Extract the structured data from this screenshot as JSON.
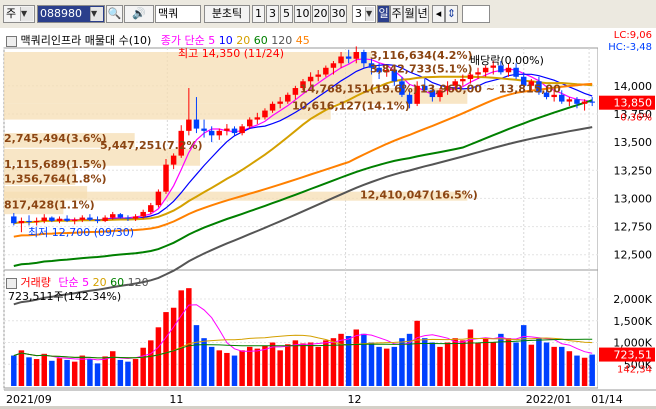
{
  "toolbar": {
    "market": "주",
    "code": "088980",
    "name": "맥쿼",
    "period_label": "분초틱",
    "periods": [
      "1",
      "3",
      "5",
      "10",
      "20",
      "30"
    ],
    "minute_value": "3",
    "day": "일",
    "week": "주",
    "month": "월",
    "year": "년"
  },
  "price_panel": {
    "title": "맥쿼리인프라 매물대 수(10)",
    "ma_label": "종가 단순",
    "ma_periods": [
      "5",
      "10",
      "20",
      "60",
      "120",
      "45"
    ],
    "lc_label": "LC:9,06",
    "hc_label": "HC:-3,48",
    "current_price": "13,850",
    "change_pct": "0.36%",
    "high_note": "최고 14,350 (11/24)",
    "low_note": "최저 12,700 (09/30)",
    "ex_dividend_note": "배당락(0.00%)",
    "volume_profile_labels": [
      "3,116,634(4.2%)",
      "3,842,733(5.1%)",
      "14,768,151(19.6%)",
      "13,960,00 ~ 13,815,00",
      "10,616,127(14.1%)",
      "2,745,494(3.6%)",
      "5,447,251(7.2%)",
      "1,115,689(1.5%)",
      "1,356,764(1.8%)",
      "817,428(1.1%)",
      "12,410,047(16.5%)"
    ]
  },
  "volume_panel": {
    "title": "거래량",
    "ma_label": "단순",
    "ma_periods": [
      "5",
      "20",
      "60",
      "120"
    ],
    "current_volume": "723,511주(142.34%)",
    "right_badge": "723,51",
    "right_badge2": "142,34"
  },
  "chart_data": {
    "type": "candlestick",
    "title": "맥쿼리인프라 매물대 수(10)",
    "price_axis_ticks": [
      12500,
      12750,
      13000,
      13250,
      13500,
      13750,
      14000
    ],
    "price_ylim": [
      12400,
      14300
    ],
    "volume_axis_ticks": [
      "500K",
      "1,000K",
      "1,500K",
      "2,000K"
    ],
    "volume_ylim": [
      0,
      2300
    ],
    "date_ticks": [
      "2021/09",
      "11",
      "12",
      "2022/01",
      "01/14"
    ],
    "candles": [
      [
        12840,
        12870,
        12760,
        12780,
        700
      ],
      [
        12780,
        12830,
        12700,
        12800,
        820
      ],
      [
        12800,
        12850,
        12760,
        12790,
        660
      ],
      [
        12790,
        12830,
        12760,
        12800,
        620
      ],
      [
        12800,
        12860,
        12780,
        12830,
        740
      ],
      [
        12830,
        12840,
        12790,
        12800,
        580
      ],
      [
        12800,
        12840,
        12780,
        12820,
        640
      ],
      [
        12820,
        12850,
        12790,
        12800,
        600
      ],
      [
        12800,
        12830,
        12770,
        12810,
        560
      ],
      [
        12810,
        12850,
        12790,
        12830,
        700
      ],
      [
        12830,
        12860,
        12800,
        12810,
        620
      ],
      [
        12810,
        12840,
        12780,
        12800,
        520
      ],
      [
        12800,
        12850,
        12790,
        12830,
        680
      ],
      [
        12830,
        12880,
        12810,
        12860,
        800
      ],
      [
        12860,
        12870,
        12820,
        12830,
        600
      ],
      [
        12830,
        12850,
        12800,
        12820,
        560
      ],
      [
        12820,
        12860,
        12800,
        12840,
        620
      ],
      [
        12840,
        12900,
        12820,
        12880,
        880
      ],
      [
        12880,
        12960,
        12860,
        12940,
        1050
      ],
      [
        12940,
        13080,
        12920,
        13060,
        1350
      ],
      [
        13060,
        13350,
        13040,
        13300,
        1700
      ],
      [
        13300,
        13400,
        13260,
        13380,
        1800
      ],
      [
        13380,
        13650,
        13360,
        13600,
        2200
      ],
      [
        13600,
        13980,
        13560,
        13700,
        2250
      ],
      [
        13700,
        13900,
        13580,
        13620,
        1400
      ],
      [
        13620,
        13700,
        13540,
        13600,
        1100
      ],
      [
        13600,
        13640,
        13500,
        13560,
        900
      ],
      [
        13560,
        13620,
        13520,
        13600,
        820
      ],
      [
        13600,
        13660,
        13560,
        13620,
        760
      ],
      [
        13620,
        13640,
        13560,
        13580,
        700
      ],
      [
        13580,
        13660,
        13560,
        13640,
        820
      ],
      [
        13640,
        13720,
        13620,
        13700,
        900
      ],
      [
        13700,
        13760,
        13660,
        13720,
        860
      ],
      [
        13720,
        13800,
        13700,
        13780,
        920
      ],
      [
        13780,
        13860,
        13760,
        13840,
        1000
      ],
      [
        13840,
        13900,
        13800,
        13860,
        820
      ],
      [
        13860,
        13940,
        13840,
        13920,
        960
      ],
      [
        13920,
        14000,
        13880,
        13980,
        1050
      ],
      [
        13980,
        14060,
        13960,
        14040,
        980
      ],
      [
        14040,
        14120,
        14000,
        14080,
        1000
      ],
      [
        14080,
        14140,
        14040,
        14100,
        900
      ],
      [
        14100,
        14180,
        14080,
        14160,
        1050
      ],
      [
        14160,
        14220,
        14100,
        14200,
        1100
      ],
      [
        14200,
        14300,
        14160,
        14260,
        1200
      ],
      [
        14260,
        14320,
        14200,
        14240,
        1150
      ],
      [
        14240,
        14350,
        14200,
        14300,
        1300
      ],
      [
        14300,
        14320,
        14160,
        14200,
        1200
      ],
      [
        14200,
        14240,
        14100,
        14160,
        1000
      ],
      [
        14160,
        14200,
        14060,
        14120,
        900
      ],
      [
        14120,
        14180,
        14080,
        14140,
        860
      ],
      [
        14140,
        14160,
        14000,
        14040,
        900
      ],
      [
        14040,
        14080,
        13900,
        13920,
        1100
      ],
      [
        13920,
        13960,
        13800,
        13840,
        1200
      ],
      [
        13840,
        14040,
        13820,
        14000,
        1500
      ],
      [
        14000,
        14060,
        13940,
        13960,
        1100
      ],
      [
        13960,
        14000,
        13860,
        13900,
        1000
      ],
      [
        13900,
        13980,
        13860,
        13960,
        900
      ],
      [
        13960,
        14040,
        13920,
        14000,
        1000
      ],
      [
        14000,
        14060,
        13960,
        14040,
        1100
      ],
      [
        14040,
        14100,
        14000,
        14060,
        1050
      ],
      [
        14060,
        14120,
        14020,
        14100,
        1300
      ],
      [
        14100,
        14160,
        14060,
        14120,
        1000
      ],
      [
        14120,
        14180,
        14080,
        14160,
        1100
      ],
      [
        14160,
        14220,
        14100,
        14180,
        1000
      ],
      [
        14180,
        14220,
        14100,
        14120,
        1200
      ],
      [
        14120,
        14200,
        14080,
        14160,
        1100
      ],
      [
        14160,
        14200,
        14060,
        14080,
        1000
      ],
      [
        14080,
        14120,
        13960,
        14000,
        1400
      ],
      [
        14000,
        14060,
        13960,
        14040,
        950
      ],
      [
        14040,
        14080,
        13920,
        13940,
        1100
      ],
      [
        13940,
        14000,
        13880,
        13900,
        1000
      ],
      [
        13900,
        13960,
        13860,
        13920,
        900
      ],
      [
        13920,
        13960,
        13840,
        13860,
        900
      ],
      [
        13860,
        13900,
        13820,
        13880,
        800
      ],
      [
        13880,
        13900,
        13800,
        13840,
        700
      ],
      [
        13840,
        13880,
        13780,
        13860,
        650
      ],
      [
        13860,
        13900,
        13820,
        13850,
        723
      ]
    ],
    "ma_series": [
      {
        "name": "5",
        "color": "#ff00ff"
      },
      {
        "name": "10",
        "color": "#0000ff"
      },
      {
        "name": "20",
        "color": "#d4a000"
      },
      {
        "name": "60",
        "color": "#008000"
      },
      {
        "name": "120",
        "color": "#555555"
      },
      {
        "name": "45",
        "color": "#ff8000"
      }
    ]
  },
  "colors": {
    "up": "#ff0000",
    "down": "#0040ff",
    "ma5": "#ff00ff",
    "ma10": "#0000ff",
    "ma20": "#d4a000",
    "ma60": "#008000",
    "ma120": "#555555",
    "ma45": "#ff8000",
    "volume_band": "#f5deb3",
    "current_price_badge": "#ff0000"
  }
}
